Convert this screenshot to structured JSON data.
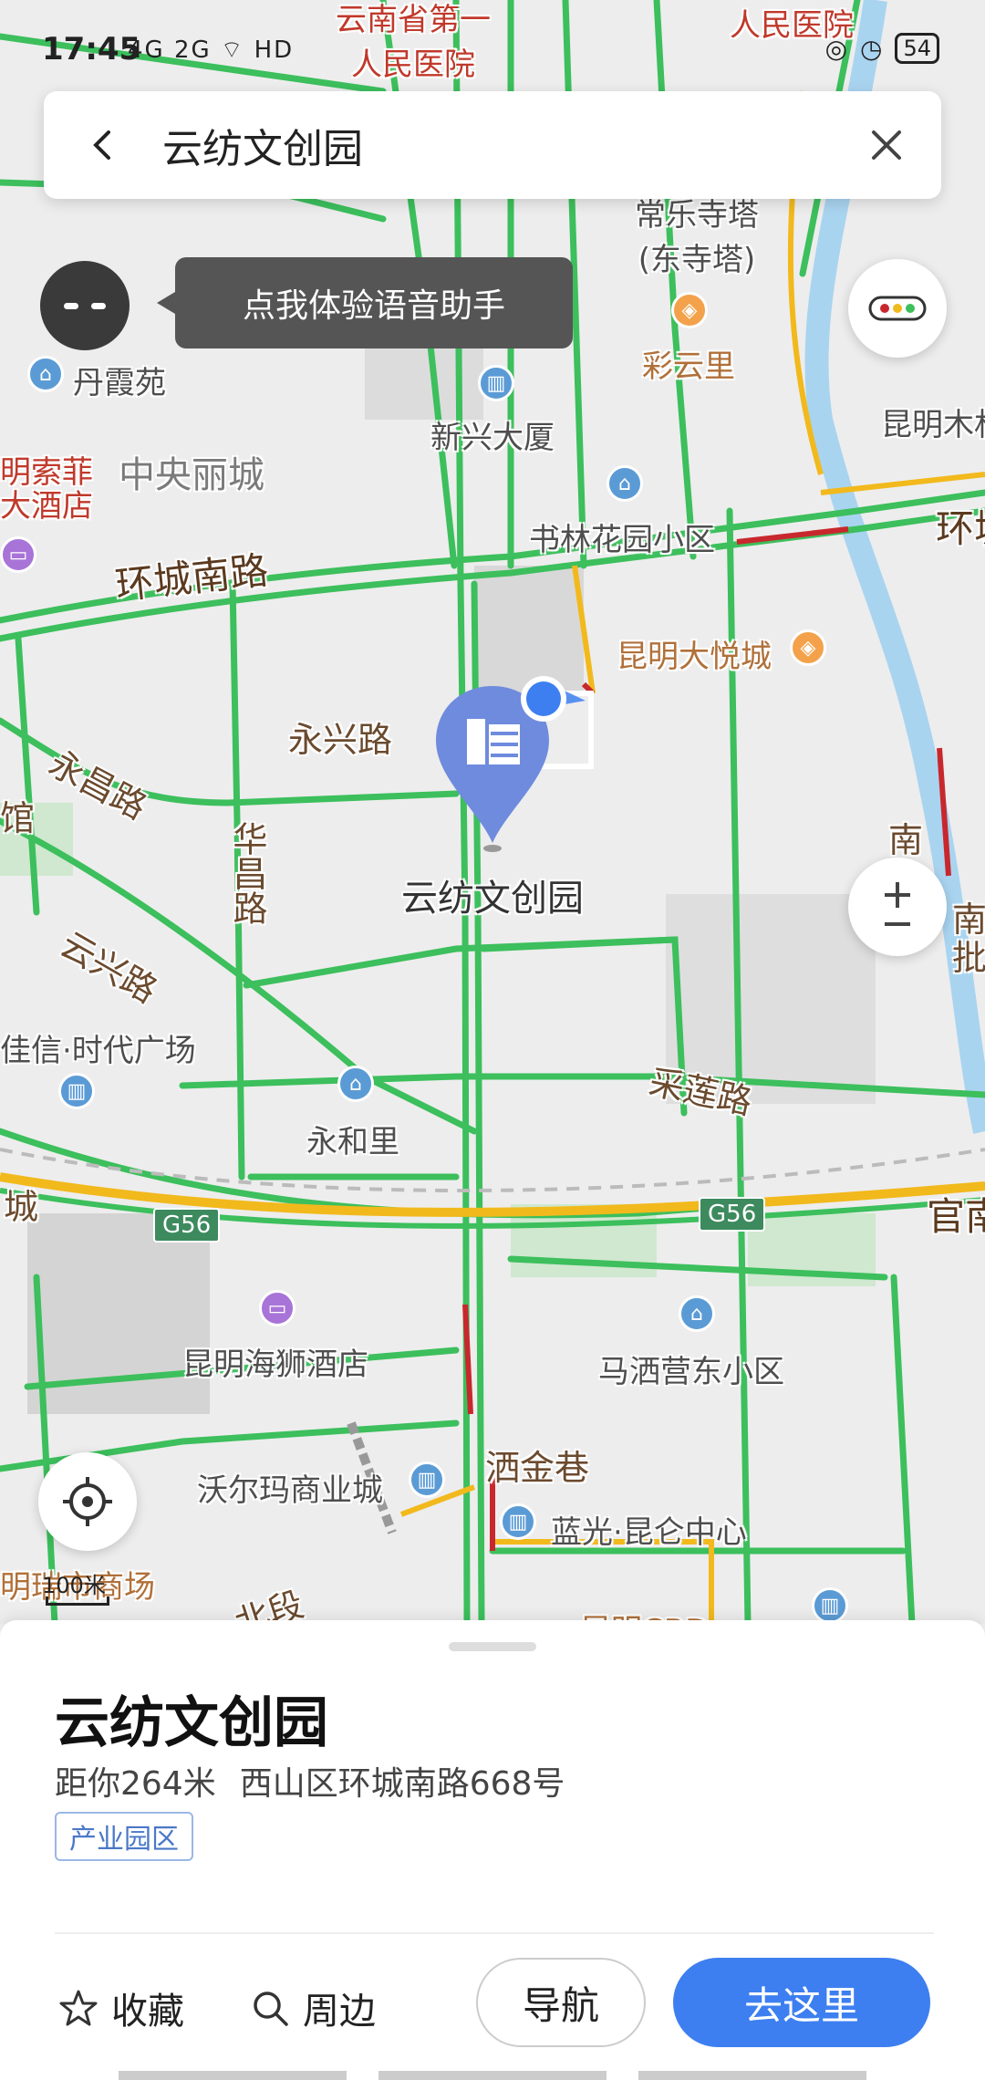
{
  "status_bar": {
    "time": "17:45",
    "signal": "4G 2G ⌔ HD",
    "battery": "54"
  },
  "search": {
    "query": "云纺文创园"
  },
  "assistant": {
    "bubble_text": "点我体验语音助手"
  },
  "map": {
    "scale_label": "100米",
    "target_label": "云纺文创园",
    "highway_shields": [
      "G56",
      "G56"
    ],
    "labels": {
      "yunnan_hospital": "云南省第一\n人民医院",
      "people_hospital": "人民医院",
      "changle_temple": "常乐寺塔\n(东寺塔)",
      "caiyunli": "彩云里",
      "danxiayuan": "丹霞苑",
      "xinxing_building": "新兴大厦",
      "kunming_mu": "昆明木材",
      "zhongyang_licheng": "中央丽城",
      "mingsuofei": "明索菲\n大酒店",
      "shulin_garden": "书林花园小区",
      "huancheng_south": "环城南路",
      "huancheng_right": "环城",
      "kunming_dayuecheng": "昆明大悦城",
      "yongxing_road": "永兴路",
      "yongchang_road": "永昌路",
      "huachang_road": "华昌路",
      "yunxing_road": "云兴路",
      "shidai_plaza": "佳信·时代广场",
      "yonghe_li": "永和里",
      "cailian_road": "采莲路",
      "kunming_haishi": "昆明海狮酒店",
      "masaiying": "马洒营东小区",
      "jiujin_lane": "洒金巷",
      "walmart": "沃尔玛商业城",
      "languang": "蓝光·昆仑中心",
      "mingrui": "明瑞市商场",
      "beiduan": "北段",
      "guandu": "官南",
      "nan": "南",
      "nanpi": "南\n批",
      "cheng": "城",
      "guan": "馆",
      "kunming_cbd": "昆明CBD"
    }
  },
  "place": {
    "name": "云纺文创园",
    "distance": "距你264米",
    "address": "西山区环城南路668号",
    "category": "产业园区"
  },
  "actions": {
    "favorite": "收藏",
    "nearby": "周边",
    "navigate": "导航",
    "go": "去这里"
  },
  "colors": {
    "accent": "#3d7ff0",
    "road_green": "#3cbf5c",
    "road_yellow": "#f2b91c",
    "road_red": "#c8282d",
    "river": "#a9d4f0"
  }
}
